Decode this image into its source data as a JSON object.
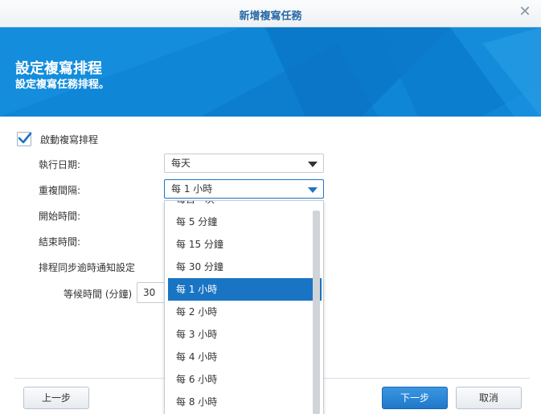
{
  "dialog": {
    "title": "新增複寫任務",
    "close_glyph": "✕"
  },
  "banner": {
    "heading": "設定複寫排程",
    "subheading": "設定複寫任務排程。",
    "color": "#0f86d6"
  },
  "form": {
    "enable_schedule_label": "啟動複寫排程",
    "enable_schedule_checked": true,
    "run_date_label": "執行日期:",
    "run_date_value": "每天",
    "repeat_label": "重複間隔:",
    "repeat_value": "每 1 小時",
    "start_time_label": "開始時間:",
    "end_time_label": "結束時間:",
    "overdue_notify_label": "排程同步逾時通知設定",
    "wait_time_label": "等候時間 (分鐘)",
    "wait_time_value": "30"
  },
  "dropdown": {
    "options": [
      "每日一次",
      "每 5 分鐘",
      "每 15 分鐘",
      "每 30 分鐘",
      "每 1 小時",
      "每 2 小時",
      "每 3 小時",
      "每 4 小時",
      "每 6 小時",
      "每 8 小時"
    ],
    "selected": "每 1 小時",
    "selected_color": "#1a74c4"
  },
  "buttons": {
    "back": "上一步",
    "next": "下一步",
    "cancel": "取消"
  }
}
